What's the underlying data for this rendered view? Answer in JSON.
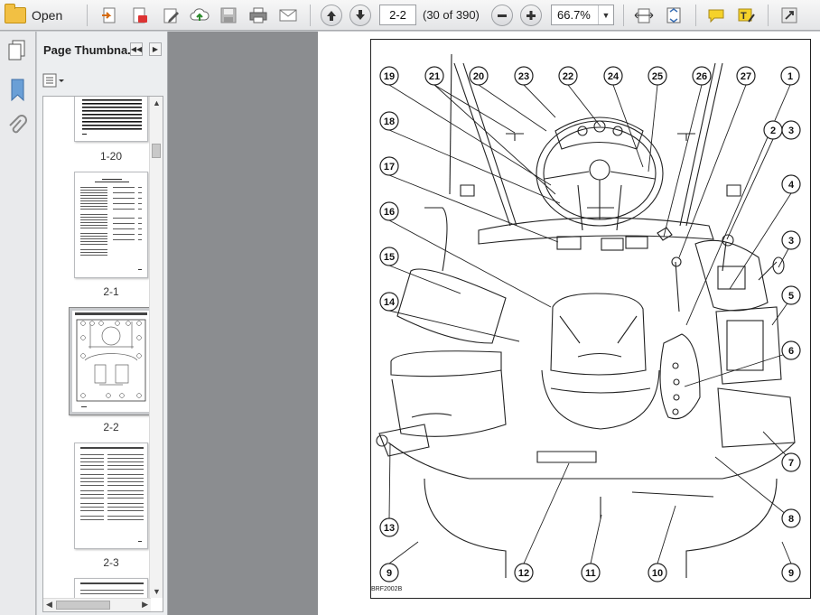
{
  "toolbar": {
    "open_label": "Open",
    "page_value": "2-2",
    "page_count": "(30 of 390)",
    "zoom_value": "66.7%"
  },
  "panel": {
    "title": "Page Thumbna...",
    "thumbnails": [
      {
        "label": "1-20"
      },
      {
        "label": "2-1"
      },
      {
        "label": "2-2"
      },
      {
        "label": "2-3"
      }
    ]
  },
  "figure": {
    "code": "BRF2002B",
    "callouts": [
      "19",
      "21",
      "20",
      "23",
      "22",
      "24",
      "25",
      "26",
      "27",
      "1",
      "2",
      "3",
      "18",
      "4",
      "17",
      "16",
      "3",
      "15",
      "5",
      "14",
      "6",
      "13",
      "7",
      "8",
      "9",
      "12",
      "11",
      "10",
      "9"
    ]
  }
}
